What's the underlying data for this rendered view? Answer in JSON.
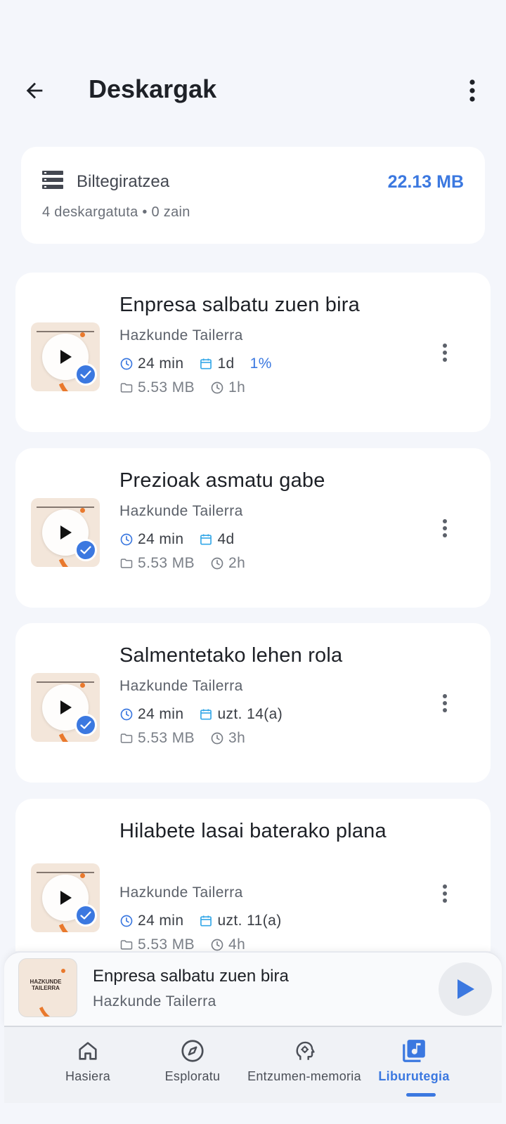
{
  "header": {
    "title": "Deskargak"
  },
  "storage": {
    "label": "Biltegiratzea",
    "size": "22.13 MB",
    "meta": "4 deskargatuta • 0 zain"
  },
  "episodes": [
    {
      "title": "Enpresa salbatu zuen bira",
      "author": "Hazkunde Tailerra",
      "duration": "24 min",
      "date": "1d",
      "progress": "1%",
      "file_size": "5.53 MB",
      "downloaded_ago": "1h"
    },
    {
      "title": "Prezioak asmatu gabe",
      "author": "Hazkunde Tailerra",
      "duration": "24 min",
      "date": "4d",
      "progress": "",
      "file_size": "5.53 MB",
      "downloaded_ago": "2h"
    },
    {
      "title": "Salmentetako lehen rola",
      "author": "Hazkunde Tailerra",
      "duration": "24 min",
      "date": "uzt. 14(a)",
      "progress": "",
      "file_size": "5.53 MB",
      "downloaded_ago": "3h"
    },
    {
      "title": "Hilabete lasai baterako plana",
      "author": "Hazkunde Tailerra",
      "duration": "24 min",
      "date": "uzt. 11(a)",
      "progress": "",
      "file_size": "5.53 MB",
      "downloaded_ago": "4h"
    }
  ],
  "mini_player": {
    "thumb_text": "HAZKUNDE TAILERRA",
    "title": "Enpresa salbatu zuen bira",
    "author": "Hazkunde Tailerra"
  },
  "nav": {
    "items": [
      {
        "label": "Hasiera",
        "icon": "home-icon"
      },
      {
        "label": "Esploratu",
        "icon": "compass-icon"
      },
      {
        "label": "Entzumen-memoria",
        "icon": "head-gear-icon"
      },
      {
        "label": "Liburutegia",
        "icon": "library-music-icon"
      }
    ],
    "active_index": 3
  },
  "colors": {
    "accent": "#3b78e0",
    "calendar": "#35a8e8",
    "thumb_orange": "#e9792d"
  }
}
